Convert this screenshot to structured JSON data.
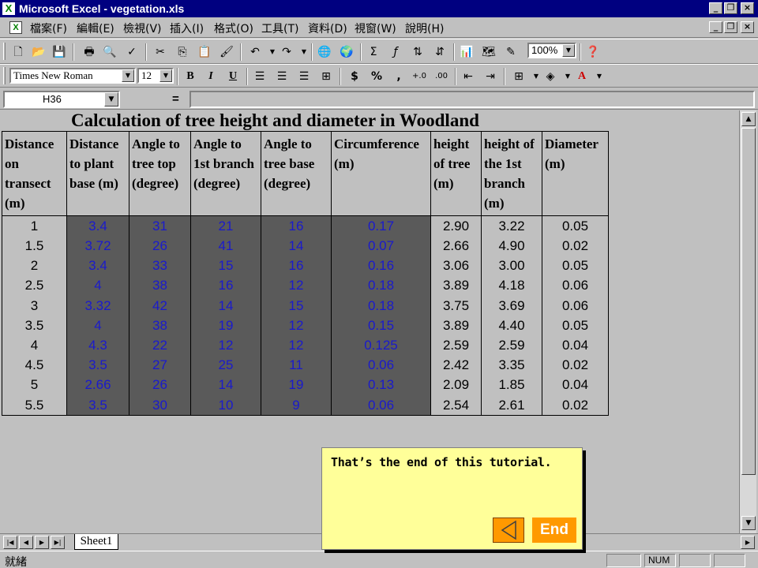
{
  "window": {
    "title": "Microsoft Excel - vegetation.xls"
  },
  "menu": [
    "檔案(F)",
    "編輯(E)",
    "檢視(V)",
    "插入(I)",
    "格式(O)",
    "工具(T)",
    "資料(D)",
    "視窗(W)",
    "說明(H)"
  ],
  "toolbar": {
    "zoom": "100%",
    "font_name": "Times New Roman",
    "font_size": "12"
  },
  "formula_bar": {
    "cell_ref": "H36",
    "equals": "="
  },
  "sheet": {
    "title": "Calculation of tree height and diameter in Woodland",
    "headers": [
      "Distance on transect (m)",
      "Distance to plant base (m)",
      "Angle to tree top (degree)",
      "Angle to 1st branch (degree)",
      "Angle to tree base (degree)",
      "Circumference (m)",
      "height of tree (m)",
      "height of the 1st branch (m)",
      "Diameter (m)"
    ],
    "rows": [
      [
        "1",
        "3.4",
        "31",
        "21",
        "16",
        "0.17",
        "2.90",
        "3.22",
        "0.05"
      ],
      [
        "1.5",
        "3.72",
        "26",
        "41",
        "14",
        "0.07",
        "2.66",
        "4.90",
        "0.02"
      ],
      [
        "2",
        "3.4",
        "33",
        "15",
        "16",
        "0.16",
        "3.06",
        "3.00",
        "0.05"
      ],
      [
        "2.5",
        "4",
        "38",
        "16",
        "12",
        "0.18",
        "3.89",
        "4.18",
        "0.06"
      ],
      [
        "3",
        "3.32",
        "42",
        "14",
        "15",
        "0.18",
        "3.75",
        "3.69",
        "0.06"
      ],
      [
        "3.5",
        "4",
        "38",
        "19",
        "12",
        "0.15",
        "3.89",
        "4.40",
        "0.05"
      ],
      [
        "4",
        "4.3",
        "22",
        "12",
        "12",
        "0.125",
        "2.59",
        "2.59",
        "0.04"
      ],
      [
        "4.5",
        "3.5",
        "27",
        "25",
        "11",
        "0.06",
        "2.42",
        "3.35",
        "0.02"
      ],
      [
        "5",
        "2.66",
        "26",
        "14",
        "19",
        "0.13",
        "2.09",
        "1.85",
        "0.04"
      ],
      [
        "5.5",
        "3.5",
        "30",
        "10",
        "9",
        "0.06",
        "2.54",
        "2.61",
        "0.02"
      ]
    ]
  },
  "tabs": {
    "sheet": "Sheet1"
  },
  "status": {
    "text": "就緒",
    "num": "NUM"
  },
  "note": {
    "text": "That’s the end of this tutorial.",
    "end_label": "End"
  },
  "colors": {
    "accent": "#ff9900",
    "note_bg": "#ffff99",
    "input_cell_bg": "#5a5a5a",
    "input_text": "#1a1acc",
    "titlebar": "#000080"
  }
}
